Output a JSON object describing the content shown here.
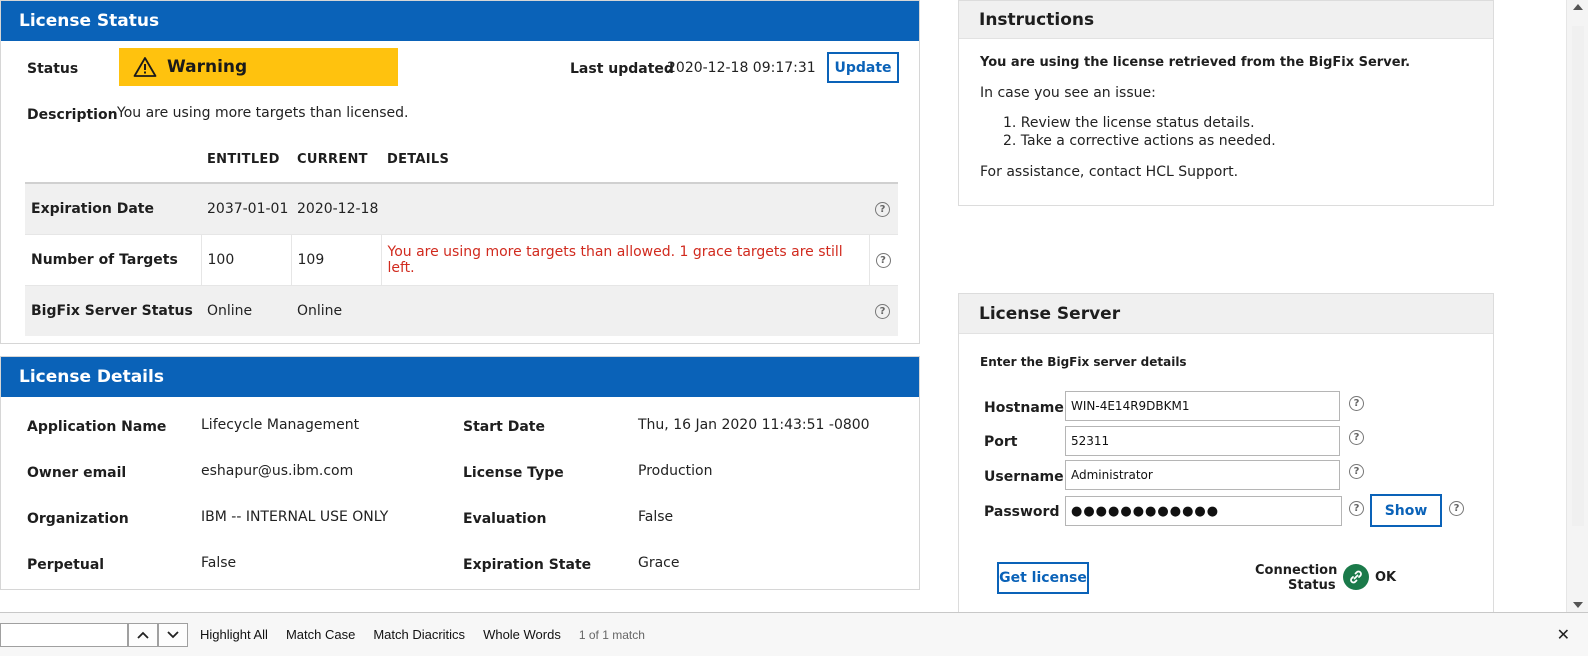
{
  "license_status": {
    "title": "License Status",
    "status_label": "Status",
    "status_value": "Warning",
    "last_updated_label": "Last updated",
    "last_updated_value": "2020-12-18 09:17:31",
    "update_button": "Update",
    "description_label": "Description",
    "description_value": "You are using more targets than licensed.",
    "table": {
      "headers": [
        "",
        "ENTITLED",
        "CURRENT",
        "DETAILS"
      ],
      "rows": [
        {
          "label": "Expiration Date",
          "entitled": "2037-01-01",
          "current": "2020-12-18",
          "details": ""
        },
        {
          "label": "Number of Targets",
          "entitled": "100",
          "current": "109",
          "details": "You are using more targets than allowed. 1 grace targets are still left."
        },
        {
          "label": "BigFix Server Status",
          "entitled": "Online",
          "current": "Online",
          "details": ""
        }
      ]
    }
  },
  "license_details": {
    "title": "License Details",
    "left": [
      {
        "label": "Application Name",
        "value": "Lifecycle Management"
      },
      {
        "label": "Owner email",
        "value": "eshapur@us.ibm.com"
      },
      {
        "label": "Organization",
        "value": "IBM -- INTERNAL USE ONLY"
      },
      {
        "label": "Perpetual",
        "value": "False"
      }
    ],
    "right": [
      {
        "label": "Start Date",
        "value": "Thu, 16 Jan 2020 11:43:51 -0800"
      },
      {
        "label": "License Type",
        "value": "Production"
      },
      {
        "label": "Evaluation",
        "value": "False"
      },
      {
        "label": "Expiration State",
        "value": "Grace"
      }
    ]
  },
  "instructions": {
    "title": "Instructions",
    "headline": "You are using the license retrieved from the BigFix Server.",
    "intro": "In case you see an issue:",
    "steps": [
      "1. Review the license status details.",
      "2. Take a corrective actions as needed."
    ],
    "assistance": "For assistance, contact HCL Support."
  },
  "license_server": {
    "title": "License Server",
    "subtitle": "Enter the BigFix server details",
    "hostname_label": "Hostname",
    "hostname_value": "WIN-4E14R9DBKM1",
    "port_label": "Port",
    "port_value": "52311",
    "username_label": "Username",
    "username_value": "Administrator",
    "password_label": "Password",
    "password_value": "●●●●●●●●●●●●",
    "show_button": "Show",
    "get_license_button": "Get license",
    "connection_label_1": "Connection",
    "connection_label_2": "Status",
    "connection_value": "OK"
  },
  "findbar": {
    "highlight_all": "Highlight All",
    "match_case": "Match Case",
    "match_diacritics": "Match Diacritics",
    "whole_words": "Whole Words",
    "match_count": "1 of 1 match",
    "close": "✕"
  },
  "colors": {
    "primary_blue": "#0a62b8",
    "warning_yellow": "#ffc20e",
    "error_red": "#d12a1e",
    "ok_green": "#1b7a4a"
  }
}
